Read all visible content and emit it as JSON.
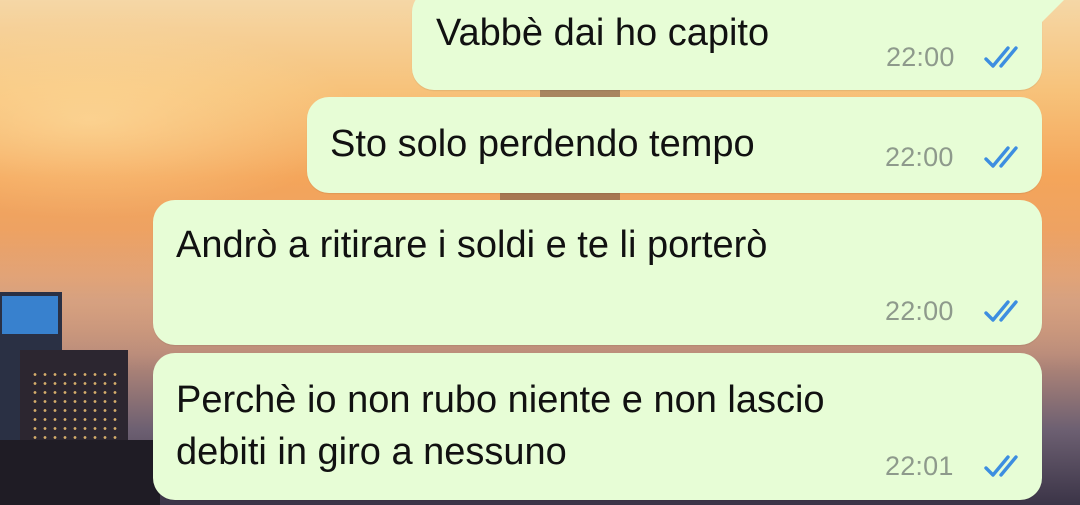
{
  "messages": [
    {
      "text": "Vabbè dai ho capito",
      "time": "22:00",
      "status": "read"
    },
    {
      "text": "Sto solo perdendo tempo",
      "time": "22:00",
      "status": "read"
    },
    {
      "text": "Andrò a ritirare i soldi e te li porterò",
      "time": "22:00",
      "status": "read"
    },
    {
      "text_lines": [
        "Perchè io non rubo niente e non lascio",
        "debiti in giro a nessuno"
      ],
      "time": "22:01",
      "status": "read"
    }
  ],
  "colors": {
    "bubble": "#e7fdd6",
    "tick_read": "#3d8ee0",
    "time_text": "#8e9a8c"
  },
  "icons": {
    "status_read": "double-check-icon"
  }
}
